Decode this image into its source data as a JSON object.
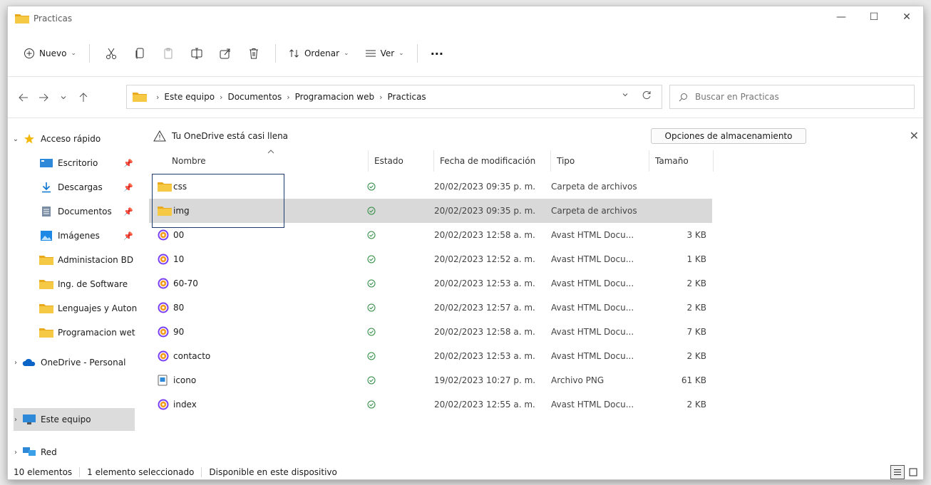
{
  "window": {
    "title": "Practicas",
    "controls": {
      "minimize": "—",
      "maximize": "☐",
      "close": "✕"
    }
  },
  "toolbar": {
    "new_label": "Nuevo",
    "sort_label": "Ordenar",
    "view_label": "Ver",
    "more_label": "···",
    "caret": "⌄"
  },
  "address": {
    "crumbs": [
      "Este equipo",
      "Documentos",
      "Programacion web",
      "Practicas"
    ],
    "separator": "›"
  },
  "search": {
    "placeholder": "Buscar en Practicas"
  },
  "sidebar": {
    "items": [
      {
        "label": "Acceso rápido",
        "expander": "⌄",
        "icon": "star-icon",
        "pinned": false
      },
      {
        "label": "Escritorio",
        "expander": "",
        "icon": "desktop-icon",
        "pinned": true
      },
      {
        "label": "Descargas",
        "expander": "",
        "icon": "download-icon",
        "pinned": true
      },
      {
        "label": "Documentos",
        "expander": "",
        "icon": "documents-icon",
        "pinned": true
      },
      {
        "label": "Imágenes",
        "expander": "",
        "icon": "pictures-icon",
        "pinned": true
      },
      {
        "label": "Administacion BD",
        "expander": "",
        "icon": "folder-icon",
        "pinned": false
      },
      {
        "label": "Ing. de Software",
        "expander": "",
        "icon": "folder-icon",
        "pinned": false
      },
      {
        "label": "Lenguajes y Auton",
        "expander": "",
        "icon": "folder-icon",
        "pinned": false
      },
      {
        "label": "Programacion wet",
        "expander": "",
        "icon": "folder-icon",
        "pinned": false
      },
      {
        "label": "OneDrive - Personal",
        "expander": "›",
        "icon": "onedrive-icon",
        "pinned": false
      },
      {
        "label": "Este equipo",
        "expander": "›",
        "icon": "computer-icon",
        "pinned": false
      },
      {
        "label": "Red",
        "expander": "›",
        "icon": "network-icon",
        "pinned": false
      }
    ]
  },
  "banner": {
    "message": "Tu OneDrive está casi llena",
    "button": "Opciones de almacenamiento",
    "close": "✕"
  },
  "columns": {
    "name": "Nombre",
    "status": "Estado",
    "modified": "Fecha de modificación",
    "type": "Tipo",
    "size": "Tamaño"
  },
  "files": [
    {
      "name": "css",
      "icon": "folder-icon",
      "status": "✓",
      "modified": "20/02/2023 09:35 p. m.",
      "type": "Carpeta de archivos",
      "size": ""
    },
    {
      "name": "img",
      "icon": "folder-icon",
      "status": "✓",
      "modified": "20/02/2023 09:35 p. m.",
      "type": "Carpeta de archivos",
      "size": ""
    },
    {
      "name": "00",
      "icon": "avast-html-icon",
      "status": "✓",
      "modified": "20/02/2023 12:58 a. m.",
      "type": "Avast HTML Docu...",
      "size": "3 KB"
    },
    {
      "name": "10",
      "icon": "avast-html-icon",
      "status": "✓",
      "modified": "20/02/2023 12:52 a. m.",
      "type": "Avast HTML Docu...",
      "size": "1 KB"
    },
    {
      "name": "60-70",
      "icon": "avast-html-icon",
      "status": "✓",
      "modified": "20/02/2023 12:53 a. m.",
      "type": "Avast HTML Docu...",
      "size": "2 KB"
    },
    {
      "name": "80",
      "icon": "avast-html-icon",
      "status": "✓",
      "modified": "20/02/2023 12:57 a. m.",
      "type": "Avast HTML Docu...",
      "size": "2 KB"
    },
    {
      "name": "90",
      "icon": "avast-html-icon",
      "status": "✓",
      "modified": "20/02/2023 12:58 a. m.",
      "type": "Avast HTML Docu...",
      "size": "7 KB"
    },
    {
      "name": "contacto",
      "icon": "avast-html-icon",
      "status": "✓",
      "modified": "20/02/2023 12:53 a. m.",
      "type": "Avast HTML Docu...",
      "size": "2 KB"
    },
    {
      "name": "icono",
      "icon": "png-file-icon",
      "status": "✓",
      "modified": "19/02/2023 10:27 p. m.",
      "type": "Archivo PNG",
      "size": "61 KB"
    },
    {
      "name": "index",
      "icon": "avast-html-icon",
      "status": "✓",
      "modified": "20/02/2023 12:55 a. m.",
      "type": "Avast HTML Docu...",
      "size": "2 KB"
    }
  ],
  "status": {
    "count": "10 elementos",
    "selected": "1 elemento seleccionado",
    "availability": "Disponible en este dispositivo"
  },
  "colors": {
    "folder": "#f4c542",
    "accent": "#0067c0",
    "status_ok": "#2b8a3e",
    "selected_row": "#d9d9d9"
  }
}
